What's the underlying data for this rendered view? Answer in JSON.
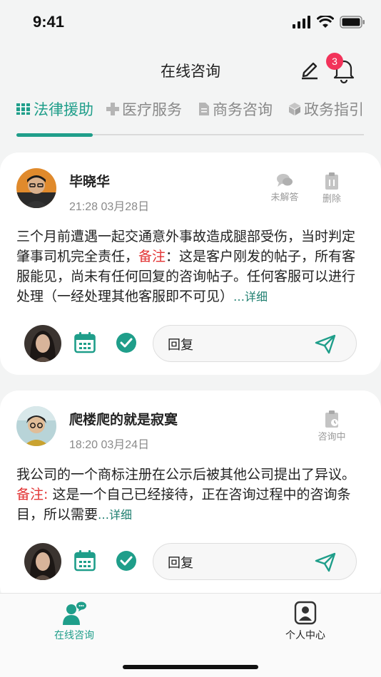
{
  "status_bar": {
    "time": "9:41"
  },
  "nav": {
    "title": "在线咨询",
    "notification_count": "3"
  },
  "tabs": [
    {
      "label": "法律援助",
      "icon": "books-icon",
      "active": true
    },
    {
      "label": "医疗服务",
      "icon": "cross-icon",
      "active": false
    },
    {
      "label": "商务咨询",
      "icon": "document-icon",
      "active": false
    },
    {
      "label": "政务指引",
      "icon": "cube-icon",
      "active": false
    }
  ],
  "posts": [
    {
      "name": "毕晓华",
      "time": "21:28 03月28日",
      "actions": [
        {
          "label": "未解答",
          "icon": "chat-bubbles-icon"
        },
        {
          "label": "删除",
          "icon": "clipboard-delete-icon"
        }
      ],
      "text_before": "三个月前遭遇一起交通意外事故造成腿部受伤，当时判定肇事司机完全责任，",
      "note_label": "备注",
      "text_after": "：这是客户刚发的帖子，所有客服能见，尚未有任何回复的咨询帖子。任何客服可以进行处理（一经处理其他客服即不可见）",
      "more": "…详细",
      "reply_label": "回复"
    },
    {
      "name": "爬楼爬的就是寂寞",
      "time": "18:20  03月24日",
      "actions": [
        {
          "label": "咨询中",
          "icon": "clipboard-clock-icon"
        }
      ],
      "text_before": "我公司的一个商标注册在公示后被其他公司提出了异议。",
      "note_label": "备注:",
      "text_after": " 这是一个自己已经接待，正在咨询过程中的咨询条目，所以需要",
      "more": "…详细",
      "reply_label": "回复"
    }
  ],
  "bottom_nav": [
    {
      "label": "在线咨询",
      "icon": "consult-icon",
      "active": true
    },
    {
      "label": "个人中心",
      "icon": "profile-icon",
      "active": false
    }
  ],
  "colors": {
    "accent": "#1f9e8a",
    "note": "#e23333",
    "badge": "#f2335a"
  }
}
